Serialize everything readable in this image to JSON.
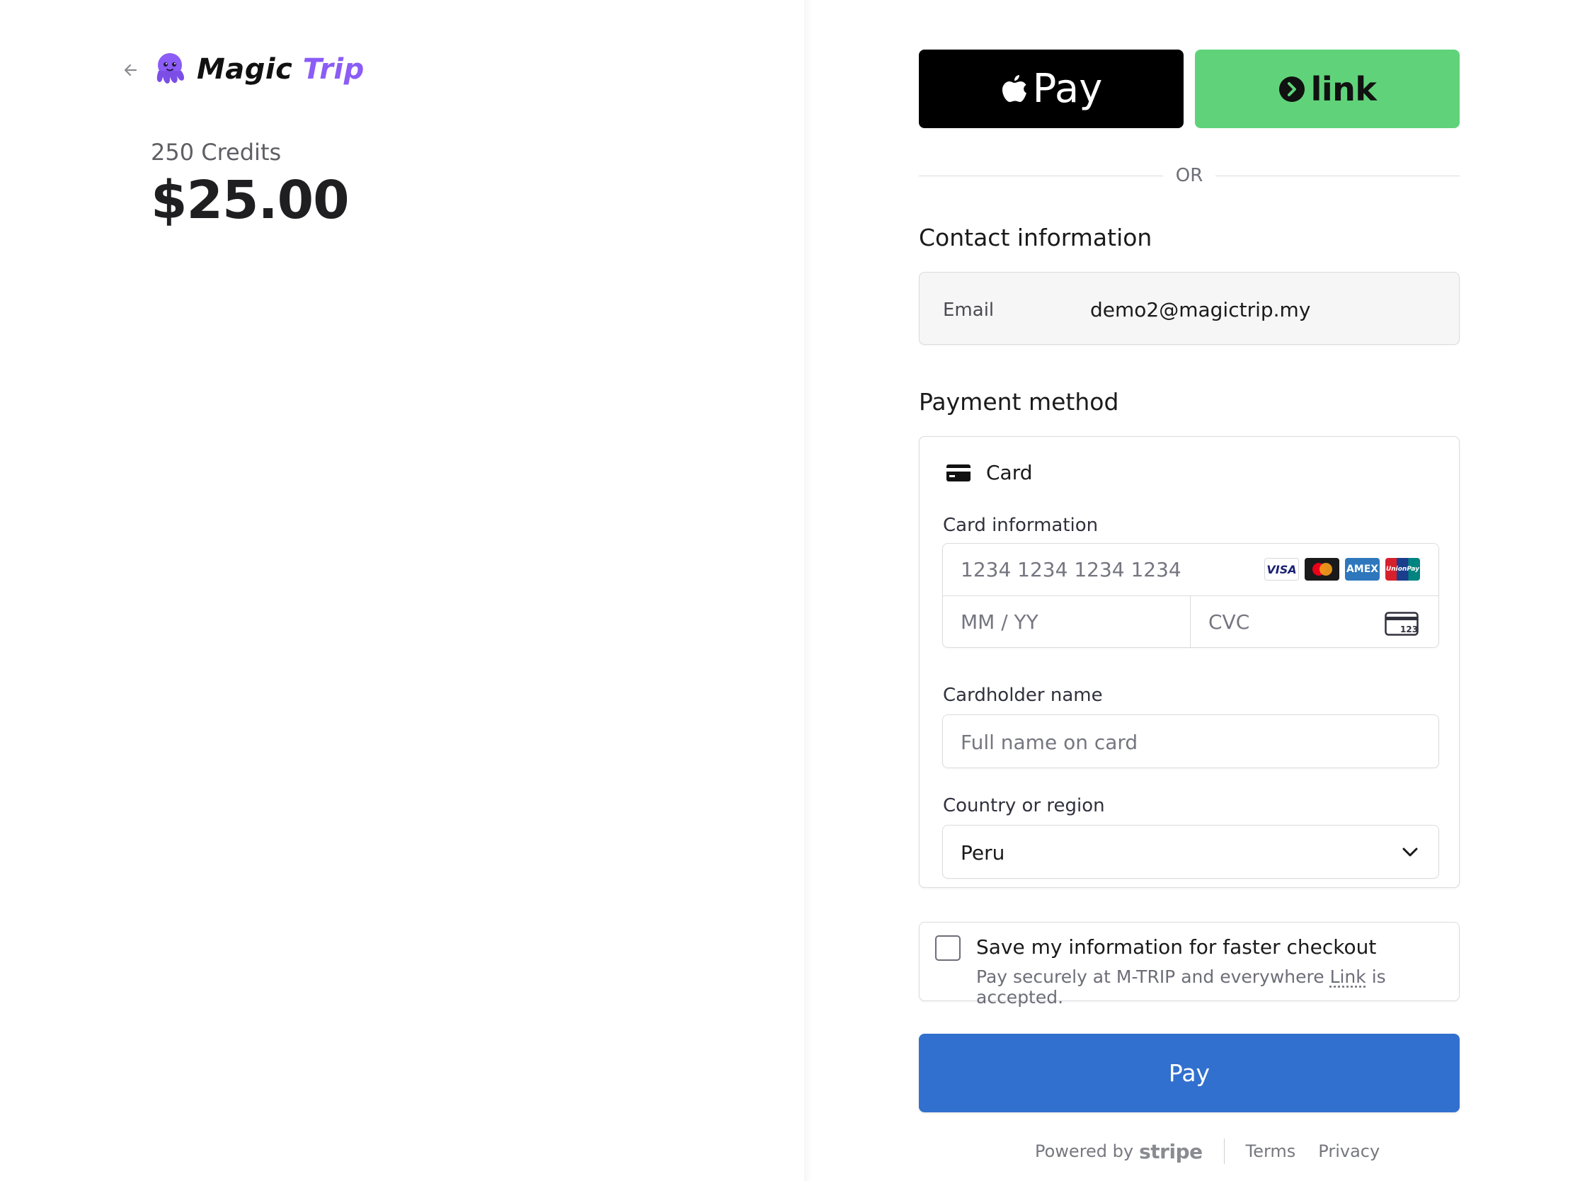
{
  "brand": {
    "name_part1": "Magic",
    "name_part2": "Trip"
  },
  "product": {
    "name": "250 Credits",
    "price": "$25.00"
  },
  "express": {
    "apple_pay_label": "Pay",
    "link_label": "link"
  },
  "divider": {
    "text": "OR"
  },
  "contact": {
    "title": "Contact information",
    "email_label": "Email",
    "email_value": "demo2@magictrip.my"
  },
  "payment": {
    "title": "Payment method",
    "method_label": "Card",
    "card_info_label": "Card information",
    "card_number_placeholder": "1234 1234 1234 1234",
    "expiry_placeholder": "MM / YY",
    "cvc_placeholder": "CVC",
    "card_brands": [
      "VISA",
      "AMEX",
      "UnionPay"
    ],
    "cvc_icon_text": "123",
    "cardholder_label": "Cardholder name",
    "cardholder_placeholder": "Full name on card",
    "country_label": "Country or region",
    "country_value": "Peru"
  },
  "save_info": {
    "title": "Save my information for faster checkout",
    "sub_prefix": "Pay securely at M-TRIP and everywhere ",
    "sub_link": "Link",
    "sub_suffix": " is accepted."
  },
  "pay_button": "Pay",
  "footer": {
    "powered_by": "Powered by",
    "stripe": "stripe",
    "terms": "Terms",
    "privacy": "Privacy"
  },
  "colors": {
    "brand_purple": "#8b5cf6",
    "pay_blue": "#3170ce",
    "link_green": "#60d37a"
  }
}
